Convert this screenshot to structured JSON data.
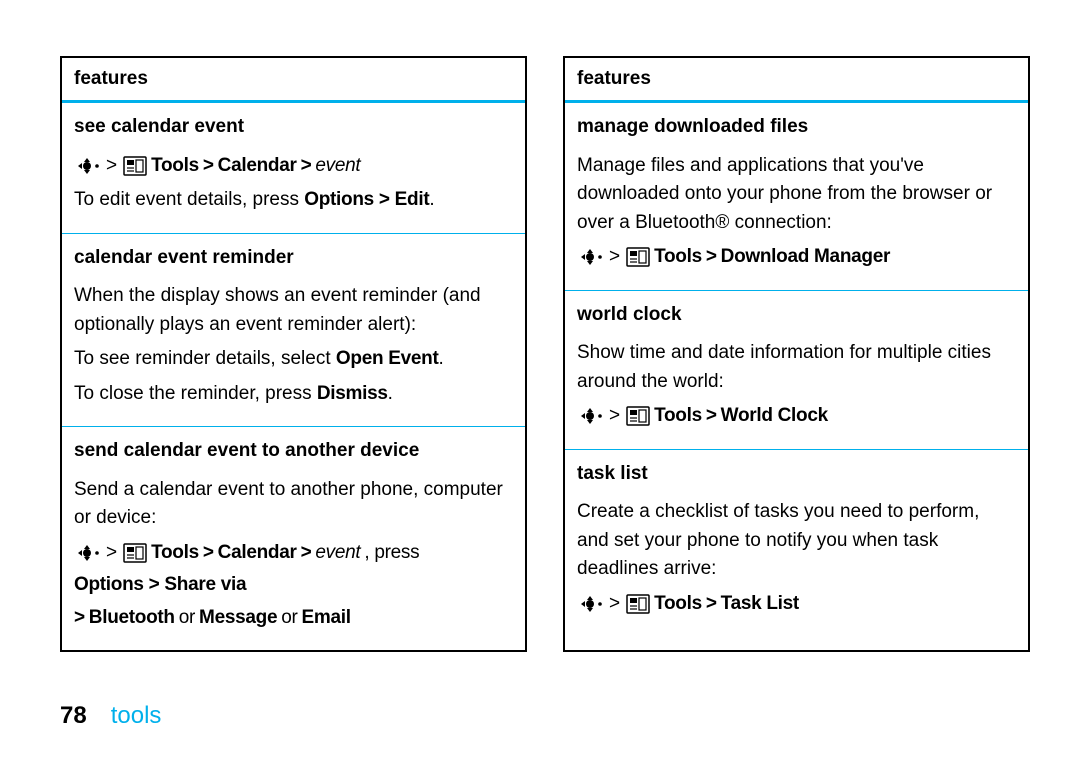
{
  "footer": {
    "page": "78",
    "section": "tools"
  },
  "left": {
    "header": "features",
    "cells": [
      {
        "title": "see calendar event",
        "nav": {
          "path1": "Tools",
          "sep": ">",
          "path2": "Calendar",
          "tail_italic": "event"
        },
        "body1_pre": "To edit event details, press ",
        "body1_cond": "Options > Edit",
        "body1_post": "."
      },
      {
        "title": "calendar event reminder",
        "body1": "When the display shows an event reminder (and optionally plays an event reminder alert):",
        "body2_pre": "To see reminder details, select ",
        "body2_cond": "Open Event",
        "body2_post": ".",
        "body3_pre": "To close the reminder, press ",
        "body3_cond": "Dismiss",
        "body3_post": "."
      },
      {
        "title": "send calendar event to another device",
        "body1": "Send a calendar event to another phone, computer or device:",
        "nav": {
          "path1": "Tools",
          "sep": ">",
          "path2": "Calendar",
          "tail_italic": "event",
          "after_italic": ", press ",
          "cond2": "Options > Share via",
          "line2_sep": ">",
          "line2_b1": "Bluetooth",
          "line2_or1": " or ",
          "line2_b2": "Message",
          "line2_or2": " or ",
          "line2_b3": "Email"
        }
      }
    ]
  },
  "right": {
    "header": "features",
    "cells": [
      {
        "title": "manage downloaded files",
        "body1": "Manage files and applications that you've downloaded onto your phone from the browser or over a Bluetooth® connection:",
        "nav": {
          "path1": "Tools",
          "sep": ">",
          "path2": "Download Manager"
        }
      },
      {
        "title": "world clock",
        "body1": "Show time and date information for multiple cities around the world:",
        "nav": {
          "path1": "Tools",
          "sep": ">",
          "path2": "World Clock"
        }
      },
      {
        "title": "task list",
        "body1": "Create a checklist of tasks you need to perform, and set your phone to notify you when task deadlines arrive:",
        "nav": {
          "path1": "Tools",
          "sep": ">",
          "path2": "Task List"
        }
      }
    ]
  }
}
